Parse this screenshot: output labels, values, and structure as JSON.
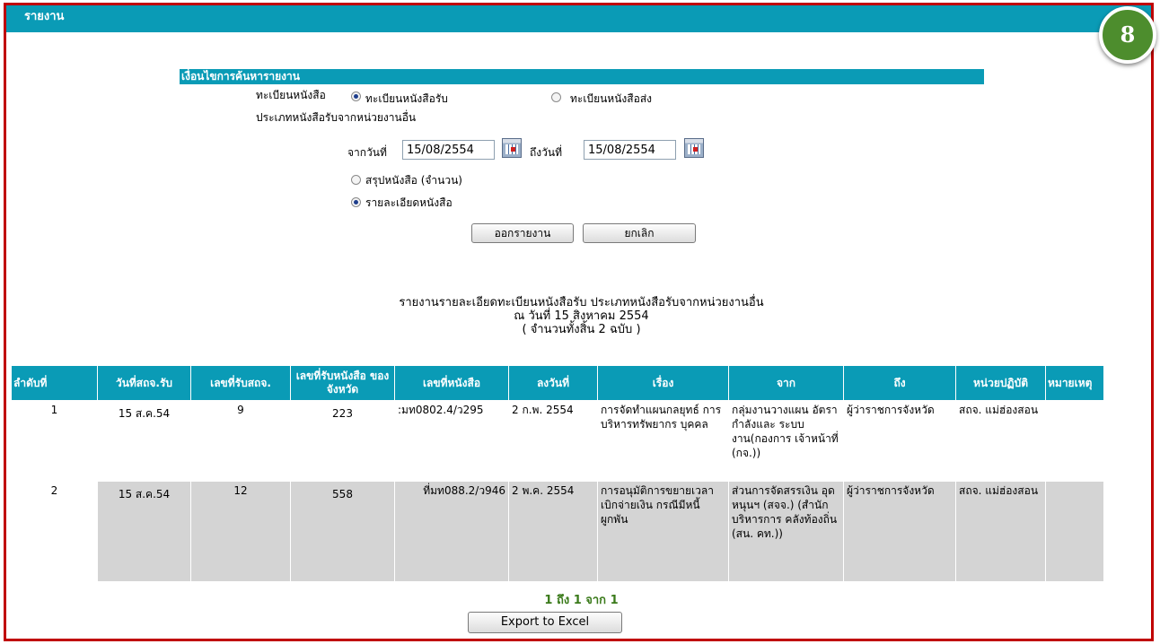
{
  "header": {
    "title": "รายงาน"
  },
  "badge": {
    "number": "8",
    "color": "#4d8d2d"
  },
  "criteria": {
    "heading": "เงื่อนไขการค้นหารายงาน",
    "register_label": "ทะเบียนหนังสือ",
    "register_options": [
      "ทะเบียนหนังสือรับ",
      "ทะเบียนหนังสือส่ง"
    ],
    "register_selected": "ทะเบียนหนังสือรับ",
    "type_label": "ประเภทหนังสือรับจากหน่วยงานอื่น",
    "from_label": "จากวันที่",
    "from_value": "15/08/2554",
    "to_label": "ถึงวันที่",
    "to_value": "15/08/2554",
    "report_options": [
      "สรุปหนังสือ (จำนวน)",
      "รายละเอียดหนังสือ"
    ],
    "report_selected": "รายละเอียดหนังสือ",
    "submit_label": "ออกรายงาน",
    "cancel_label": "ยกเลิก"
  },
  "summary": {
    "line1": "รายงานรายละเอียดทะเบียนหนังสือรับ ประเภทหนังสือรับจากหน่วยงานอื่น",
    "line2": "ณ วันที่ 15 สิงหาคม 2554",
    "line3": "( จำนวนทั้งสิ้น 2 ฉบับ )"
  },
  "table": {
    "columns": [
      "ลำดับที่",
      "วันที่สถจ.รับ",
      "เลขที่รับสถจ.",
      "เลขที่รับหนังสือ ของจังหวัด",
      "เลขที่หนังสือ",
      "ลงวันที่",
      "เรื่อง",
      "จาก",
      "ถึง",
      "หน่วยปฏิบัติ",
      "หมายเหตุ"
    ],
    "rows": [
      [
        "1",
        "15 ส.ค.54",
        "9",
        "223",
        ":มท0802.4/ว295",
        "2 ก.พ. 2554",
        "การจัดทำแผนกลยุทธ์ การบริหารทรัพยากร บุคคล",
        "กลุ่มงานวางแผน อัตรากำลังและ ระบบงาน(กองการ เจ้าหน้าที่ (กจ.))",
        "ผู้ว่าราชการจังหวัด",
        "สถจ. แม่ฮ่องสอน",
        ""
      ],
      [
        "2",
        "15 ส.ค.54",
        "12",
        "558",
        "ที่มท088.2/ว946",
        "2 พ.ค. 2554",
        "การอนุมัติการขยายเวลา เบิกจ่ายเงิน กรณีมีหนี้ ผูกพัน",
        "ส่วนการจัดสรรเงิน อุดหนุนฯ (สจจ.) (สำนักบริหารการ คลังท้องถิ่น (สน. คท.))",
        "ผู้ว่าราชการจังหวัด",
        "สถจ. แม่ฮ่องสอน",
        ""
      ]
    ]
  },
  "pager": {
    "text": "1 ถึง 1 จาก 1"
  },
  "export": {
    "label": "Export to Excel"
  },
  "colors": {
    "header_bg": "#0a9bb6",
    "frame_border": "#c00000",
    "pager_text": "#3a7a1a"
  }
}
